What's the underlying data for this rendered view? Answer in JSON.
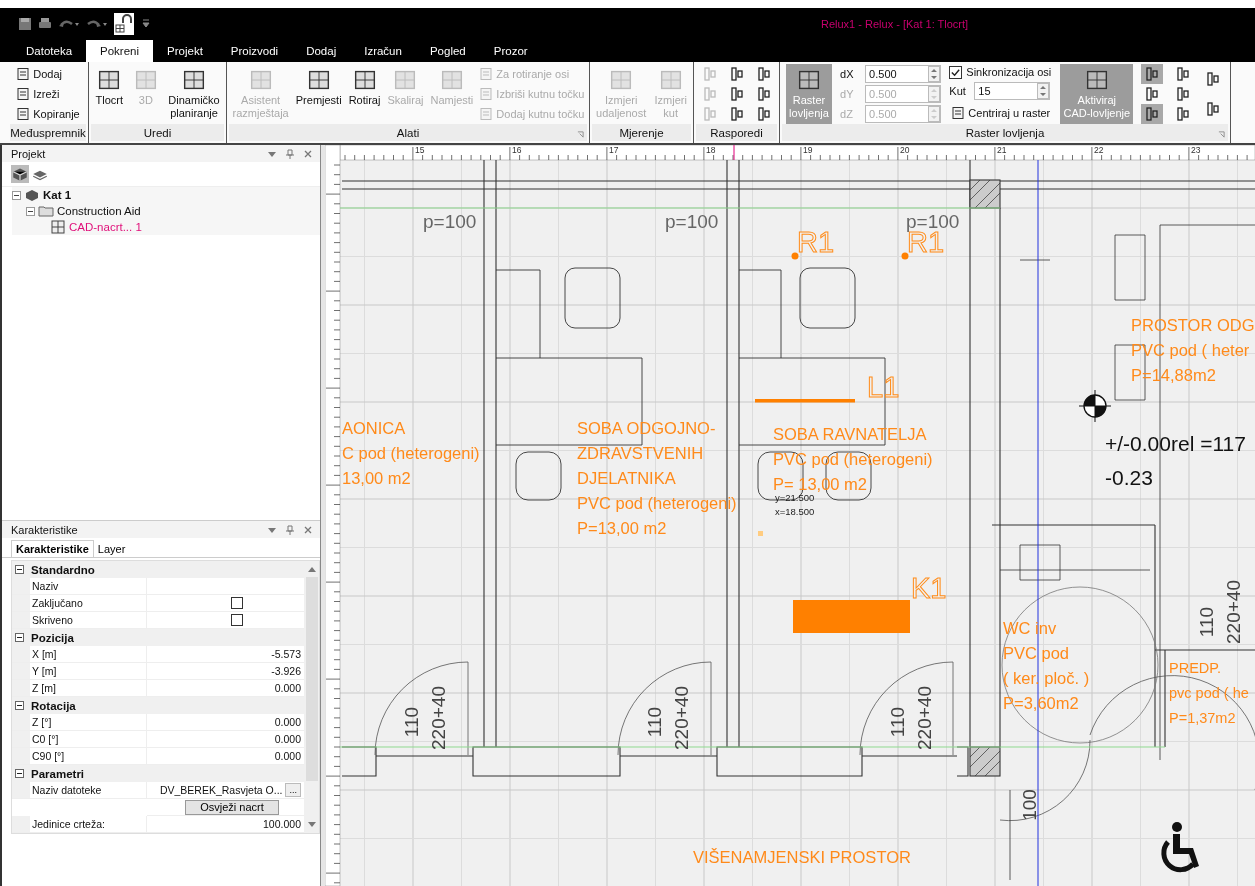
{
  "window": {
    "title": "Relux1 - Relux - [Kat 1: Tlocrt]"
  },
  "tabs": [
    {
      "label": "Datoteka",
      "selected": false
    },
    {
      "label": "Pokreni",
      "selected": true
    },
    {
      "label": "Projekt",
      "selected": false
    },
    {
      "label": "Proizvodi",
      "selected": false
    },
    {
      "label": "Dodaj",
      "selected": false
    },
    {
      "label": "Izračun",
      "selected": false
    },
    {
      "label": "Pogled",
      "selected": false
    },
    {
      "label": "Prozor",
      "selected": false
    }
  ],
  "ribbon": {
    "groups": [
      {
        "label": "Međuspremnik",
        "launcher": false,
        "columns": [
          [
            {
              "kind": "small",
              "label": "Dodaj",
              "disabled": false
            },
            {
              "kind": "small",
              "label": "Izreži",
              "disabled": false
            },
            {
              "kind": "small",
              "label": "Kopiranje",
              "disabled": false
            }
          ]
        ]
      },
      {
        "label": "Uredi",
        "launcher": false,
        "columns": [
          [
            {
              "kind": "large",
              "label": "Tlocrt",
              "disabled": false,
              "on": false
            }
          ],
          [
            {
              "kind": "large",
              "label": "3D",
              "disabled": true,
              "on": false
            }
          ],
          [
            {
              "kind": "large",
              "label": "Dinamičko\nplaniranje",
              "disabled": false,
              "on": false
            }
          ]
        ]
      },
      {
        "label": "Alati",
        "launcher": true,
        "columns": [
          [
            {
              "kind": "large",
              "label": "Asistent\nrazmještaja",
              "disabled": true,
              "on": false
            }
          ],
          [
            {
              "kind": "large",
              "label": "Premjesti",
              "disabled": false,
              "on": false
            }
          ],
          [
            {
              "kind": "large",
              "label": "Rotiraj",
              "disabled": false,
              "on": false
            }
          ],
          [
            {
              "kind": "large",
              "label": "Skaliraj",
              "disabled": true,
              "on": false
            }
          ],
          [
            {
              "kind": "large",
              "label": "Namjesti",
              "disabled": true,
              "on": false
            }
          ],
          [
            {
              "kind": "small",
              "label": "Za rotiranje osi",
              "disabled": true
            },
            {
              "kind": "small",
              "label": "Izbriši kutnu točku",
              "disabled": true
            },
            {
              "kind": "small",
              "label": "Dodaj kutnu točku",
              "disabled": true
            }
          ]
        ]
      },
      {
        "label": "Mjerenje",
        "launcher": false,
        "columns": [
          [
            {
              "kind": "large",
              "label": "Izmjeri\nudaljenost",
              "disabled": true,
              "on": false
            }
          ],
          [
            {
              "kind": "large",
              "label": "Izmjeri\nkut",
              "disabled": true,
              "on": false
            }
          ]
        ]
      },
      {
        "label": "Rasporedi",
        "launcher": false,
        "columns": [
          [
            {
              "kind": "icon",
              "disabled": true,
              "on": false
            },
            {
              "kind": "icon",
              "disabled": true,
              "on": false
            },
            {
              "kind": "icon",
              "disabled": true,
              "on": false
            }
          ],
          [
            {
              "kind": "icon",
              "disabled": false,
              "on": false
            },
            {
              "kind": "icon",
              "disabled": false,
              "on": false
            },
            {
              "kind": "icon",
              "disabled": false,
              "on": false
            }
          ],
          [
            {
              "kind": "icon",
              "disabled": false,
              "on": false
            },
            {
              "kind": "icon",
              "disabled": false,
              "on": false
            },
            {
              "kind": "icon",
              "disabled": false,
              "on": false
            }
          ]
        ]
      },
      {
        "label": "Raster lovljenja",
        "launcher": true,
        "columns": [
          [
            {
              "kind": "large",
              "label": "Raster\nlovljenja",
              "disabled": false,
              "on": true
            }
          ],
          [
            {
              "kind": "field",
              "label": "dX",
              "value": "0.500",
              "disabled": false
            },
            {
              "kind": "field",
              "label": "dY",
              "value": "0.500",
              "disabled": true
            },
            {
              "kind": "field",
              "label": "dZ",
              "value": "0.500",
              "disabled": true
            }
          ],
          [
            {
              "kind": "check",
              "label": "Sinkronizacija osi",
              "checked": true
            },
            {
              "kind": "field",
              "label": "Kut",
              "value": "15",
              "disabled": false
            },
            {
              "kind": "small",
              "label": "Centriraj u raster",
              "disabled": false
            }
          ],
          [
            {
              "kind": "large",
              "label": "Aktiviraj\nCAD-lovljenje",
              "disabled": false,
              "on": true
            }
          ],
          [
            {
              "kind": "icon",
              "disabled": false,
              "on": true
            },
            {
              "kind": "icon",
              "disabled": false,
              "on": false
            },
            {
              "kind": "icon",
              "disabled": false,
              "on": true
            }
          ],
          [
            {
              "kind": "icon",
              "disabled": false,
              "on": false
            },
            {
              "kind": "icon",
              "disabled": false,
              "on": false
            },
            {
              "kind": "icon",
              "disabled": false,
              "on": false
            }
          ],
          [
            {
              "kind": "icon",
              "disabled": false,
              "on": false
            },
            {
              "kind": "icon",
              "disabled": false,
              "on": false
            }
          ]
        ]
      }
    ]
  },
  "project_panel": {
    "title": "Projekt",
    "tree": [
      {
        "label": "Kat 1",
        "selected": false,
        "expanded": true,
        "children": [
          {
            "label": "Construction Aid",
            "selected": false,
            "expanded": true,
            "children": [
              {
                "label": "CAD-nacrt... 1",
                "selected": true
              }
            ]
          }
        ]
      }
    ]
  },
  "properties_panel": {
    "title": "Karakteristike",
    "tabs": [
      {
        "label": "Karakteristike",
        "selected": true
      },
      {
        "label": "Layer",
        "selected": false
      }
    ],
    "sections": [
      {
        "label": "Standardno",
        "rows": [
          {
            "kind": "text",
            "label": "Naziv"
          },
          {
            "kind": "check",
            "label": "Zaključano",
            "checked": false
          },
          {
            "kind": "check",
            "label": "Skriveno",
            "checked": false
          }
        ]
      },
      {
        "label": "Pozicija",
        "rows": [
          {
            "kind": "text",
            "label": "X [m]",
            "value": "-5.573"
          },
          {
            "kind": "text",
            "label": "Y [m]",
            "value": "-3.926"
          },
          {
            "kind": "text",
            "label": "Z [m]",
            "value": "0.000"
          }
        ]
      },
      {
        "label": "Rotacija",
        "rows": [
          {
            "kind": "text",
            "label": "Z [°]",
            "value": "0.000"
          },
          {
            "kind": "text",
            "label": "C0 [°]",
            "value": "0.000"
          },
          {
            "kind": "text",
            "label": "C90 [°]",
            "value": "0.000"
          }
        ]
      },
      {
        "label": "Parametri",
        "rows": [
          {
            "kind": "file",
            "label": "Naziv datoteke",
            "value": "DV_BEREK_Rasvjeta O...",
            "button": "..."
          },
          {
            "kind": "button",
            "value": "Osvježi nacrt"
          },
          {
            "kind": "text",
            "label": "Jedinice crteža:",
            "value": "100.000"
          }
        ]
      }
    ]
  },
  "canvas": {
    "ruler_numbers": [
      "15",
      "16",
      "17",
      "18",
      "19",
      "20",
      "21",
      "22",
      "23"
    ],
    "labels": [
      {
        "kind": "dimension",
        "text": "p=100"
      },
      {
        "kind": "dimension",
        "text": "p=100"
      },
      {
        "kind": "dimension",
        "text": "p=100"
      },
      {
        "kind": "tag",
        "text": "R1"
      },
      {
        "kind": "tag",
        "text": "R1"
      },
      {
        "kind": "tag",
        "text": "L1"
      },
      {
        "kind": "tag",
        "text": "K1"
      },
      {
        "kind": "room",
        "lines": [
          "AONICA",
          "C pod (heterogeni)",
          "13,00 m2"
        ]
      },
      {
        "kind": "room",
        "lines": [
          "SOBA ODGOJNO-",
          "ZDRAVSTVENIH",
          "DJELATNIKA",
          "PVC pod (heterogeni)",
          "P=13,00 m2"
        ]
      },
      {
        "kind": "room",
        "lines": [
          "SOBA RAVNATELJA",
          "PVC pod (heterogeni)",
          "P= 13,00 m2"
        ]
      },
      {
        "kind": "coordinate",
        "text": "y=21.500"
      },
      {
        "kind": "coordinate",
        "text": "x=18.500"
      },
      {
        "kind": "room",
        "lines": [
          "PROSTOR ODG",
          "PVC pod ( heter",
          "P=14,88m2"
        ]
      },
      {
        "kind": "level",
        "text": "+/-0.00rel =117"
      },
      {
        "kind": "level",
        "text": "-0.23"
      },
      {
        "kind": "room",
        "lines": [
          "WC inv",
          "PVC pod",
          "( ker. ploč. )",
          "P=3,60m2"
        ]
      },
      {
        "kind": "room",
        "lines": [
          "PREDP.",
          "pvc pod ( he",
          "P=1,37m2"
        ]
      },
      {
        "kind": "room",
        "lines": [
          "VIŠENAMJENSKI PROSTOR"
        ]
      },
      {
        "kind": "door-size",
        "text": "110"
      },
      {
        "kind": "door-size",
        "text": "220+40"
      },
      {
        "kind": "door-size",
        "text": "110"
      },
      {
        "kind": "door-size",
        "text": "220+40"
      },
      {
        "kind": "door-size",
        "text": "110"
      },
      {
        "kind": "door-size",
        "text": "220+40"
      },
      {
        "kind": "door-size",
        "text": "110"
      },
      {
        "kind": "door-size",
        "text": "220+40"
      },
      {
        "kind": "door-size",
        "text": "100"
      }
    ]
  }
}
